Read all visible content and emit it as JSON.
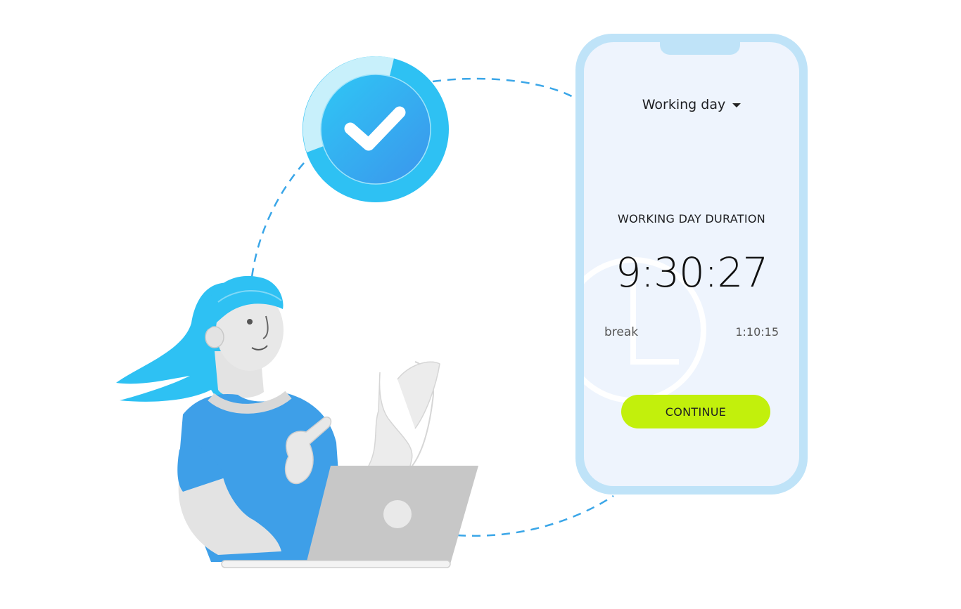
{
  "phone": {
    "mode_select": "Working day",
    "duration_title": "WORKING DAY DURATION",
    "timer": "9:30:27",
    "break_label": "break",
    "break_value": "1:10:15",
    "continue_label": "CONTINUE"
  },
  "icons": {
    "badge": "check-circle-icon",
    "dropdown": "chevron-down-icon"
  },
  "colors": {
    "accent_button": "#c2f00c",
    "phone_frame": "#bfe3f8",
    "badge_blue": "#38bdf8"
  }
}
